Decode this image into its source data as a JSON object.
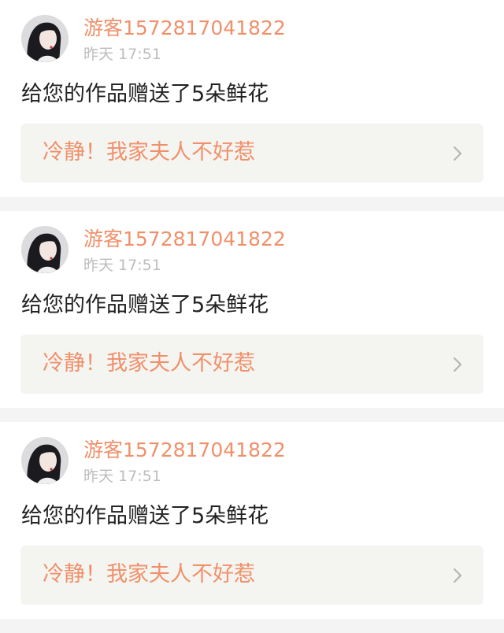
{
  "notifications": [
    {
      "username": "游客1572817041822",
      "time": "昨天 17:51",
      "message": "给您的作品赠送了5朵鲜花",
      "work_title": "冷静！我家夫人不好惹",
      "chevron_icon": "chevron-right-icon",
      "avatar_icon": "user-avatar"
    },
    {
      "username": "游客1572817041822",
      "time": "昨天 17:51",
      "message": "给您的作品赠送了5朵鲜花",
      "work_title": "冷静！我家夫人不好惹",
      "chevron_icon": "chevron-right-icon",
      "avatar_icon": "user-avatar"
    },
    {
      "username": "游客1572817041822",
      "time": "昨天 17:51",
      "message": "给您的作品赠送了5朵鲜花",
      "work_title": "冷静！我家夫人不好惹",
      "chevron_icon": "chevron-right-icon",
      "avatar_icon": "user-avatar"
    }
  ],
  "colors": {
    "accent": "#f0906a",
    "text": "#222222",
    "muted": "#bdbdbd",
    "link_bg": "#f4f4f0",
    "divider": "#f4f4f4"
  }
}
